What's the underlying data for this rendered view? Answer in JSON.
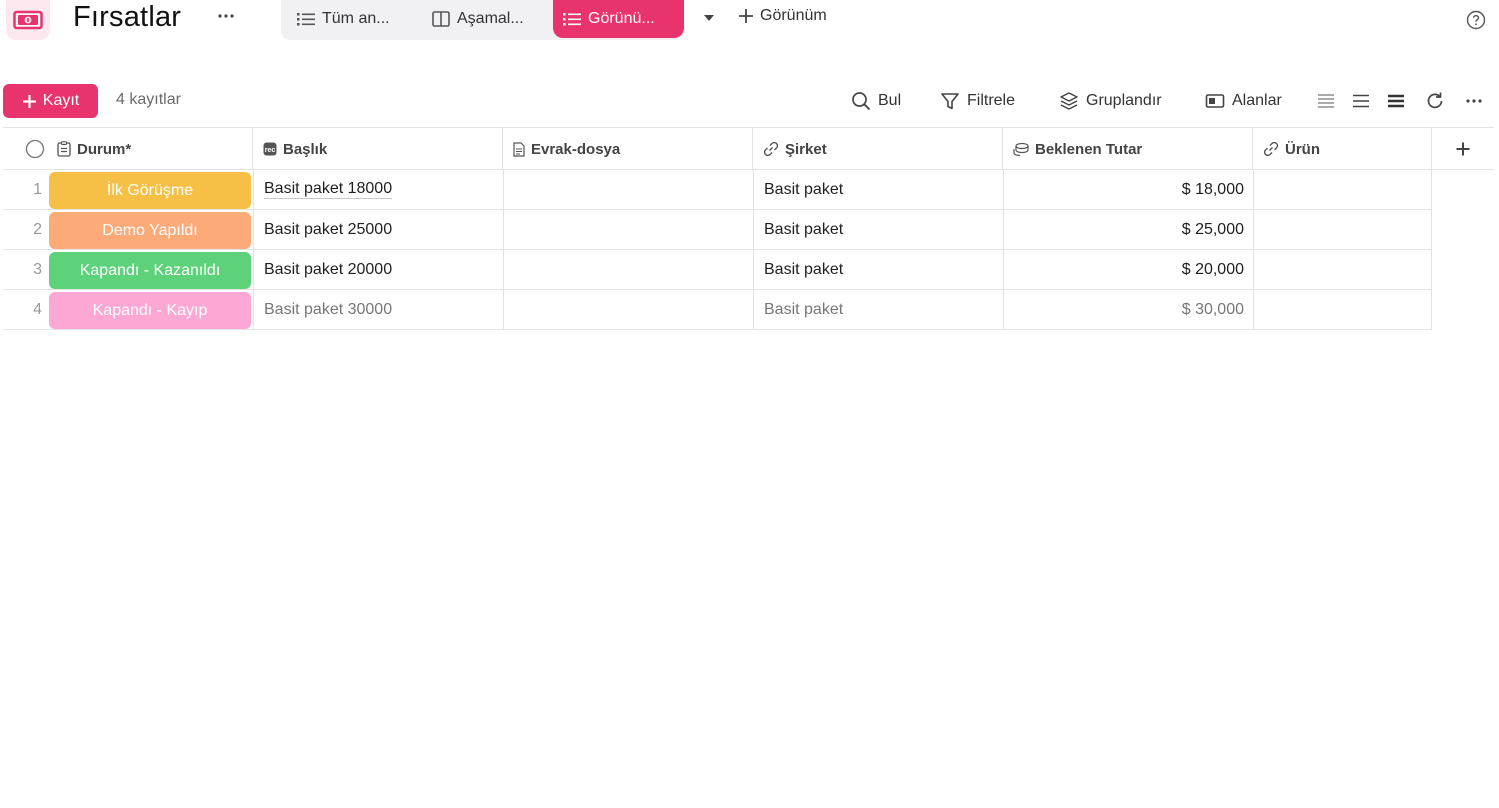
{
  "header": {
    "title": "Fırsatlar",
    "views": [
      {
        "label": "Tüm an...",
        "icon": "list-icon",
        "active": false
      },
      {
        "label": "Aşamal...",
        "icon": "kanban-icon",
        "active": false
      },
      {
        "label": "Görünü...",
        "icon": "list-icon",
        "active": true
      }
    ],
    "add_view_label": "Görünüm"
  },
  "toolbar": {
    "add_label": "Kayıt",
    "record_count": "4 kayıtlar",
    "find_label": "Bul",
    "filter_label": "Filtrele",
    "group_label": "Gruplandır",
    "fields_label": "Alanlar"
  },
  "table": {
    "columns": [
      {
        "label": "Durum*",
        "icon": "form-icon"
      },
      {
        "label": "Başlık",
        "icon": "text-field-icon"
      },
      {
        "label": "Evrak-dosya",
        "icon": "document-icon"
      },
      {
        "label": "Şirket",
        "icon": "link-icon"
      },
      {
        "label": "Beklenen Tutar",
        "icon": "currency-icon"
      },
      {
        "label": "Ürün",
        "icon": "link-icon"
      }
    ],
    "rows": [
      {
        "num": "1",
        "status": "İlk Görüşme",
        "status_color": "#f5c045",
        "title": "Basit paket 18000",
        "document": "",
        "company": "Basit paket",
        "amount": "$ 18,000",
        "product": ""
      },
      {
        "num": "2",
        "status": "Demo Yapıldı",
        "status_color": "#fdaa79",
        "title": "Basit paket 25000",
        "document": "",
        "company": "Basit paket",
        "amount": "$ 25,000",
        "product": ""
      },
      {
        "num": "3",
        "status": "Kapandı - Kazanıldı",
        "status_color": "#5dd27b",
        "title": "Basit paket 20000",
        "document": "",
        "company": "Basit paket",
        "amount": "$ 20,000",
        "product": ""
      },
      {
        "num": "4",
        "status": "Kapandı - Kayıp",
        "status_color": "#fda8d4",
        "title": "Basit paket 30000",
        "document": "",
        "company": "Basit paket",
        "amount": "$ 30,000",
        "product": ""
      }
    ]
  },
  "colors": {
    "accent": "#e9336c",
    "tab_bg": "#f1f1f3"
  }
}
